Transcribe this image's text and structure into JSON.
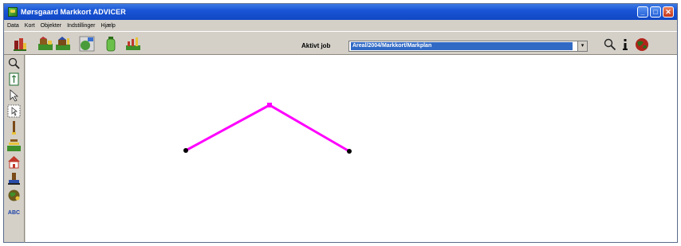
{
  "window": {
    "title": "Mørsgaard Markkort ADVICER",
    "controls": {
      "minimize": "_",
      "maximize": "□",
      "close": "✕"
    }
  },
  "menu": [
    "Data",
    "Kort",
    "Objekter",
    "Indstillinger",
    "Hjælp"
  ],
  "toolbar": {
    "tools": [
      "field-stack-icon",
      "field-edit-icon",
      "field-add-icon",
      "abc-map-icon",
      "bottle-icon",
      "field-chart-icon"
    ],
    "job_label": "Aktivt job",
    "job_value": "Areal/2004/Markkort/Markplan",
    "dropdown_arrow": "▾",
    "right_tools": [
      "search-icon",
      "info-icon",
      "earth-icon"
    ]
  },
  "left_tools": [
    "zoom-icon",
    "page-icon",
    "pointer-icon",
    "zoom-area-icon",
    "post-icon",
    "field-line-icon",
    "house-icon",
    "tractor-icon",
    "globe-icon",
    "abc-icon"
  ],
  "left_tools_abc_text": "ABC",
  "drawing": {
    "line_color": "#ff00ff",
    "vertex_color": "#000000"
  }
}
